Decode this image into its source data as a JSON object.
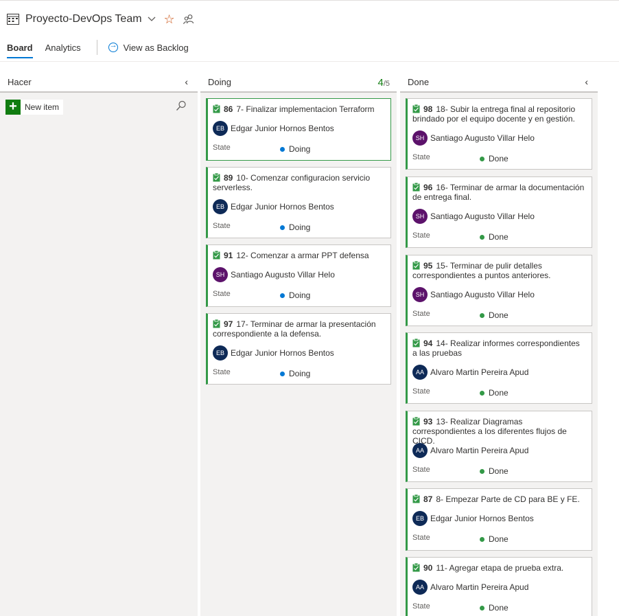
{
  "header": {
    "team_title": "Proyecto-DevOps Team",
    "tabs": [
      {
        "label": "Board",
        "active": true
      },
      {
        "label": "Analytics",
        "active": false
      }
    ],
    "view_backlog": "View as Backlog",
    "star_color": "#ca5010"
  },
  "columns": {
    "hacer": {
      "title": "Hacer",
      "new_item": "New item"
    },
    "doing": {
      "title": "Doing",
      "wip_current": "4",
      "wip_max": "5"
    },
    "done": {
      "title": "Done"
    }
  },
  "state_label": "State",
  "status_colors": {
    "Doing": "#0078d4",
    "Done": "#339947"
  },
  "doing_cards": [
    {
      "id": "86",
      "title": "7- Finalizar implementacion Terraform",
      "initials": "EB",
      "assignee": "Edgar Junior Hornos Bentos",
      "state": "Doing",
      "avatar_color": "#0e2a57"
    },
    {
      "id": "89",
      "title": "10- Comenzar configuracion servicio serverless.",
      "initials": "EB",
      "assignee": "Edgar Junior Hornos Bentos",
      "state": "Doing",
      "avatar_color": "#0e2a57"
    },
    {
      "id": "91",
      "title": "12- Comenzar a armar PPT defensa",
      "initials": "SH",
      "assignee": "Santiago Augusto Villar Helo",
      "state": "Doing",
      "avatar_color": "#5c126b"
    },
    {
      "id": "97",
      "title": "17- Terminar de armar la presentación correspondiente a la defensa.",
      "initials": "EB",
      "assignee": "Edgar Junior Hornos Bentos",
      "state": "Doing",
      "avatar_color": "#0e2a57"
    }
  ],
  "done_cards": [
    {
      "id": "98",
      "title": "18- Subir la entrega final al repositorio brindado por el equipo docente y en gestión.",
      "initials": "SH",
      "assignee": "Santiago Augusto Villar Helo",
      "state": "Done",
      "avatar_color": "#5c126b"
    },
    {
      "id": "96",
      "title": "16- Terminar de armar la documentación de entrega final.",
      "initials": "SH",
      "assignee": "Santiago Augusto Villar Helo",
      "state": "Done",
      "avatar_color": "#5c126b"
    },
    {
      "id": "95",
      "title": "15- Terminar de pulir detalles correspondientes a puntos anteriores.",
      "initials": "SH",
      "assignee": "Santiago Augusto Villar Helo",
      "state": "Done",
      "avatar_color": "#5c126b"
    },
    {
      "id": "94",
      "title": "14- Realizar informes correspondientes a las pruebas",
      "initials": "AA",
      "assignee": "Alvaro Martin Pereira Apud",
      "state": "Done",
      "avatar_color": "#0e2a57"
    },
    {
      "id": "93",
      "title": "13- Realizar Diagramas correspondientes a los diferentes flujos de CICD.",
      "initials": "AA",
      "assignee": "Alvaro Martin Pereira Apud",
      "state": "Done",
      "avatar_color": "#0e2a57"
    },
    {
      "id": "87",
      "title": "8- Empezar Parte de CD para BE y FE.",
      "initials": "EB",
      "assignee": "Edgar Junior Hornos Bentos",
      "state": "Done",
      "avatar_color": "#0e2a57"
    },
    {
      "id": "90",
      "title": "11- Agregar etapa de prueba extra.",
      "initials": "AA",
      "assignee": "Alvaro Martin Pereira Apud",
      "state": "Done",
      "avatar_color": "#0e2a57"
    }
  ]
}
